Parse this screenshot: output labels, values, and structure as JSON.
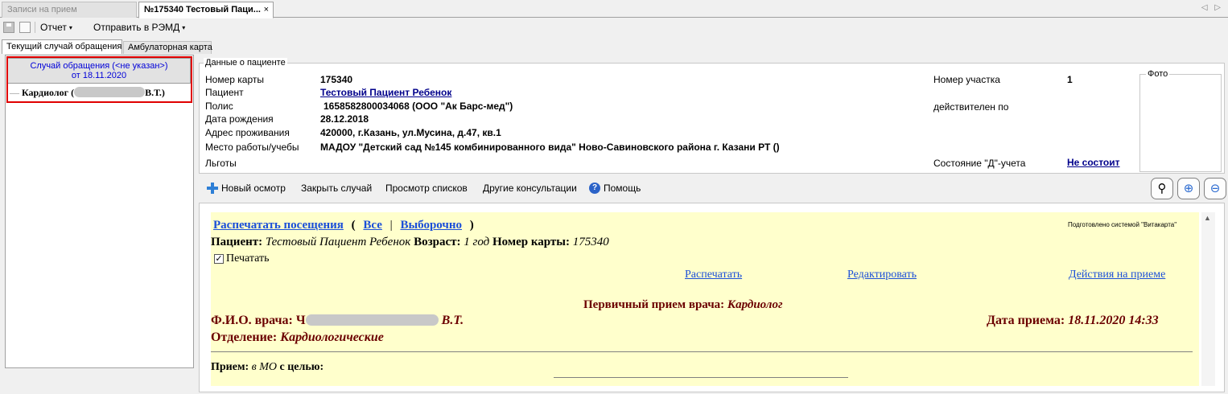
{
  "window_tabs": {
    "inactive": "Записи на прием",
    "active": "№175340 Тестовый Паци...",
    "close_glyph": "×",
    "nav_glyphs": "◁ ▷"
  },
  "toolbar": {
    "report_label": "Отчет",
    "remd_label": "Отправить в РЭМД",
    "caret": "▾"
  },
  "sub_tabs": {
    "current_case": "Текущий случай обращения",
    "outpatient_card": "Амбулаторная карта"
  },
  "left_panel": {
    "case_line1": "Случай обращения (<не указан>)",
    "case_line2": "от 18.11.2020",
    "tree_dash": "—",
    "tree_item_prefix": "Кардиолог (",
    "tree_item_suffix": "В.Т.)"
  },
  "patient": {
    "group_title": "Данные о пациенте",
    "labels": {
      "card_number": "Номер карты",
      "patient": "Пациент",
      "policy": "Полис",
      "birth_date": "Дата рождения",
      "address": "Адрес проживания",
      "workplace": "Место работы/учебы",
      "benefits": "Льготы",
      "district_number": "Номер участка",
      "valid_until": "действителен по",
      "d_status": "Состояние \"Д\"-учета",
      "photo": "Фото"
    },
    "values": {
      "card_number": "175340",
      "patient": "Тестовый Пациент Ребенок",
      "policy": "1658582800034068 (ООО \"Ак Барс-мед\")",
      "birth_date": "28.12.2018",
      "address": "420000, г.Казань, ул.Мусина, д.47, кв.1",
      "workplace": "МАДОУ \"Детский сад №145 комбинированного вида\" Ново-Савиновского района г. Казани РТ ()",
      "district_number": "1",
      "d_status": "Не состоит"
    }
  },
  "action_bar": {
    "new_exam": "Новый осмотр",
    "close_case": "Закрыть случай",
    "view_lists": "Просмотр списков",
    "other_consults": "Другие консультации",
    "help": "Помощь",
    "help_glyph": "?",
    "pin_glyph": "⚲",
    "zoom_in_glyph": "⊕",
    "zoom_out_glyph": "⊖"
  },
  "content": {
    "print_visits": "Распечатать посещения",
    "open_paren": "(",
    "all": "Все",
    "separator": "|",
    "selective": "Выборочно",
    "close_paren": ")",
    "prepared_by": "Подготовлено системой \"Витакарта\"",
    "patient_label": "Пациент:",
    "patient_name": "Тестовый Пациент Ребенок",
    "age_label": "Возраст:",
    "age_value": "1 год",
    "card_label": "Номер карты:",
    "card_value": "175340",
    "print_checkbox_label": "Печатать",
    "check_glyph": "✓",
    "print_link": "Распечатать",
    "edit_link": "Редактировать",
    "actions_link": "Действия на приеме",
    "visit_title_label": "Первичный прием врача:",
    "visit_title_value": "Кардиолог",
    "doctor_label": "Ф.И.О. врача:",
    "doctor_prefix": "Ч",
    "doctor_suffix": "В.Т.",
    "visit_date_label": "Дата приема:",
    "visit_date_value": "18.11.2020 14:33",
    "department_label": "Отделение:",
    "department_value": "Кардиологические",
    "reception_label": "Прием:",
    "reception_place": "в МО",
    "reception_purpose": "с целью:",
    "scroll_up_glyph": "▲"
  }
}
